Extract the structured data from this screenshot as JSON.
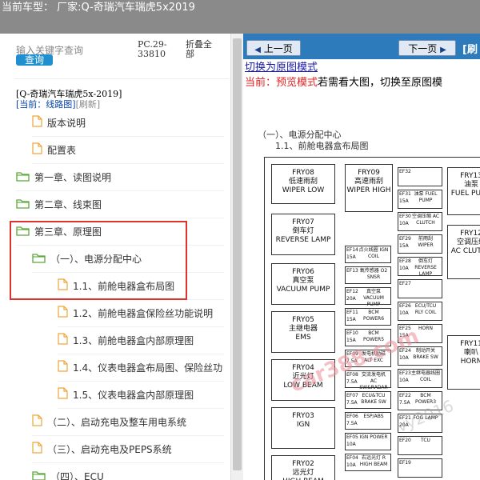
{
  "titlebar": {
    "text": "当前车型： 厂家:Q-奇瑞汽车瑞虎5x2019"
  },
  "sidebar": {
    "search_placeholder": "输入关键字查询",
    "search_button": "查询",
    "code": "PC.29-33810",
    "collapse_all": "折叠全部",
    "tree_title": "[Q-奇瑞汽车瑞虎5x-2019]",
    "current_label": "[当前：线路图]",
    "refresh": "[刷新]",
    "items": [
      {
        "label": "版本说明"
      },
      {
        "label": "配置表"
      },
      {
        "label": "第一章、读图说明"
      },
      {
        "label": "第二章、线束图"
      },
      {
        "label": "第三章、原理图"
      },
      {
        "label": "（一）、电源分配中心"
      },
      {
        "label": "1.1、前舱电器盒布局图"
      },
      {
        "label": "1.2、前舱电器盒保险丝功能说明"
      },
      {
        "label": "1.3、前舱电器盒内部原理图"
      },
      {
        "label": "1.4、仪表电器盒布局图、保险丝功"
      },
      {
        "label": "1.5、仪表电器盒内部原理图"
      },
      {
        "label": "（二）、启动充电及整车用电系统"
      },
      {
        "label": "（三）、启动充电及PEPS系统"
      },
      {
        "label": "（四）、ECU"
      }
    ]
  },
  "viewer": {
    "prev_button": "上一页",
    "next_button": "下一页",
    "next_extra": "[刷",
    "switch_link": "切换为原图模式",
    "mode_prefix": "当前：预览模式",
    "mode_rest": "若需看大图，切换至原图模",
    "doc_heading": "（一）、电源分配中心",
    "doc_subheading": "1.1、前舱电器盒布局图",
    "watermark": "car388.com",
    "watermark2": "vy2016",
    "relays": [
      {
        "id": "FRY08",
        "cn": "低速雨刮",
        "en": "WIPER LOW"
      },
      {
        "id": "FRY09",
        "cn": "高速雨刮",
        "en": "WIPER HIGH"
      },
      {
        "id": "FRY13",
        "cn": "油泵",
        "en": "FUEL PUMP"
      },
      {
        "id": "FRY07",
        "cn": "倒车灯",
        "en": "REVERSE LAMP"
      },
      {
        "id": "FRY12",
        "cn": "空调压缩",
        "en": "AC CLUTCH"
      },
      {
        "id": "FRY06",
        "cn": "真空泵",
        "en": "VACUUM PUMP"
      },
      {
        "id": "FRY05",
        "cn": "主继电器",
        "en": "EMS"
      },
      {
        "id": "FRY11",
        "cn": "喇叭",
        "en": "HORN"
      },
      {
        "id": "FRY04",
        "cn": "近光灯",
        "en": "LOW BEAM"
      },
      {
        "id": "FRY03",
        "cn": "",
        "en": "IGN"
      },
      {
        "id": "FRY02",
        "cn": "远光灯",
        "en": "HIGH BEAM"
      }
    ],
    "fuses_mid": [
      {
        "id": "EF14",
        "amp": "15A",
        "name": "点火线圈 IGN COIL"
      },
      {
        "id": "EF13",
        "amp": "",
        "name": "氧传感器 O2 SNSR"
      },
      {
        "id": "EF12",
        "amp": "20A",
        "name": "真空泵 VACUUM PUMP"
      },
      {
        "id": "EF11",
        "amp": "15A",
        "name": "BCM POWER6"
      },
      {
        "id": "EF10",
        "amp": "15A",
        "name": "BCM POWER5"
      },
      {
        "id": "EF09",
        "amp": "7.5A",
        "name": "发电机励磁 ALT EXC"
      },
      {
        "id": "EF08",
        "amp": "7.5A",
        "name": "交流发电机 AC SW&RADAR"
      },
      {
        "id": "EF07",
        "amp": "7.5A",
        "name": "ECU&TCU BRAKE SW"
      },
      {
        "id": "EF06",
        "amp": "7.5A",
        "name": "ESP/ABS"
      },
      {
        "id": "EF05",
        "amp": "10A",
        "name": "IGN POWER"
      },
      {
        "id": "EF04",
        "amp": "10A",
        "name": "右远光灯 R HIGH BEAM"
      }
    ],
    "fuses_right": [
      {
        "id": "EF32",
        "amp": "",
        "name": ""
      },
      {
        "id": "EF31",
        "amp": "15A",
        "name": "油泵 FUEL PUMP"
      },
      {
        "id": "EF30",
        "amp": "10A",
        "name": "空调压缩 AC CLUTCH"
      },
      {
        "id": "EF29",
        "amp": "15A",
        "name": "前雨刮 WIPER"
      },
      {
        "id": "EF28",
        "amp": "10A",
        "name": "倒车灯 REVERSE LAMP"
      },
      {
        "id": "EF27",
        "amp": "",
        "name": ""
      },
      {
        "id": "EF26",
        "amp": "10A",
        "name": "ECU/TCU RLY COIL"
      },
      {
        "id": "EF25",
        "amp": "15A",
        "name": "HORN"
      },
      {
        "id": "EF24",
        "amp": "10A",
        "name": "制动开关 BRAKE SW"
      },
      {
        "id": "EF23",
        "amp": "10A",
        "name": "主继电器线圈 COIL"
      },
      {
        "id": "EF22",
        "amp": "7.5A",
        "name": "BCM POWER3"
      },
      {
        "id": "EF21",
        "amp": "20A",
        "name": "FOG LAMP"
      },
      {
        "id": "EF20",
        "amp": "",
        "name": "TCU"
      },
      {
        "id": "EF19",
        "amp": "",
        "name": ""
      }
    ]
  }
}
